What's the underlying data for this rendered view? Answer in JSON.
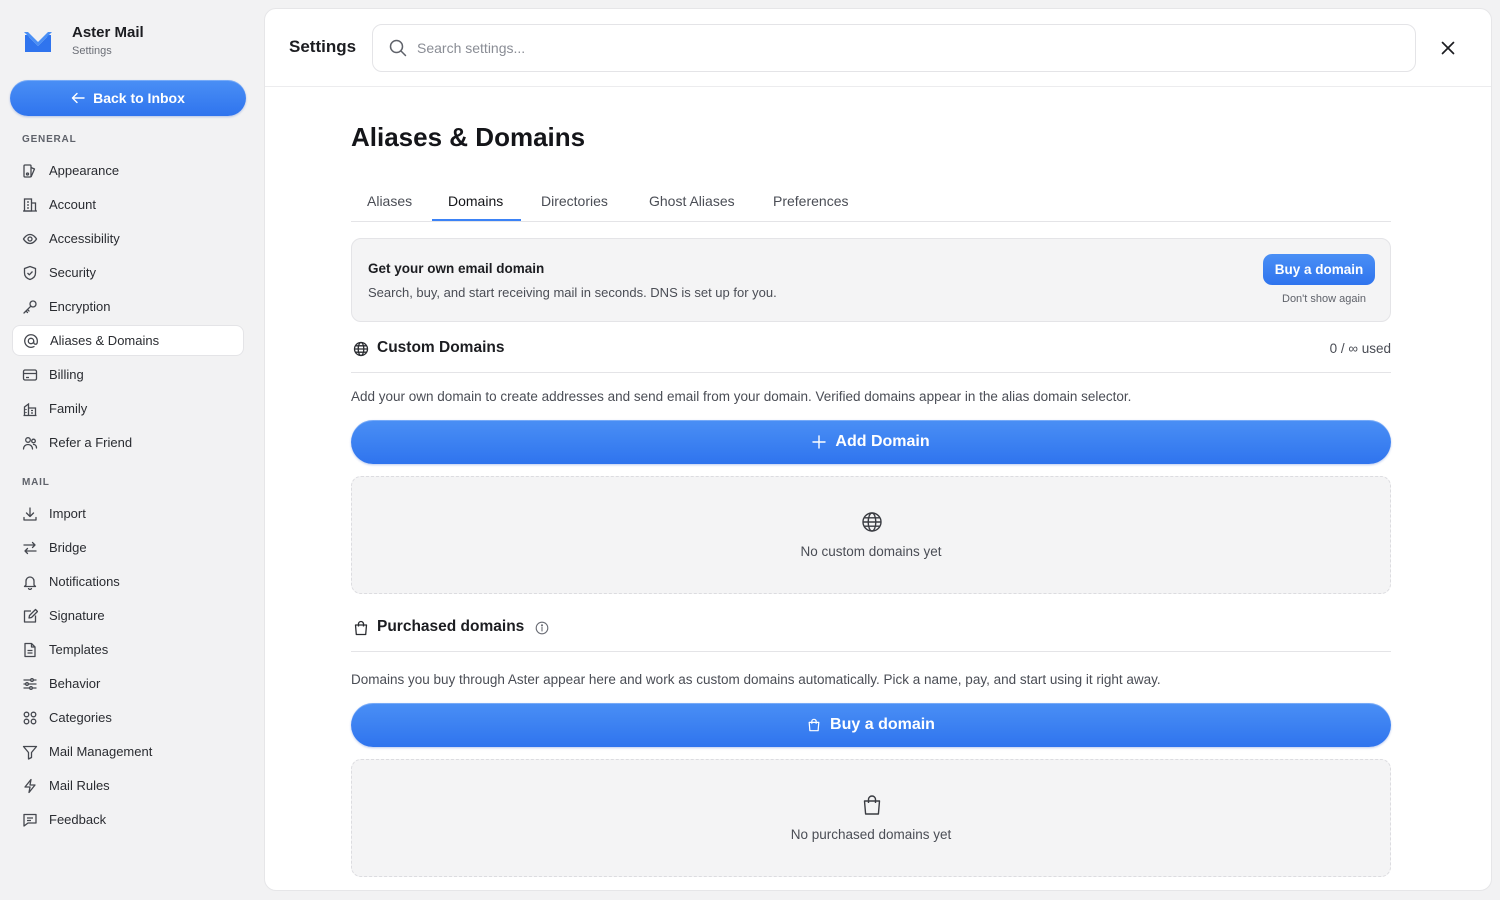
{
  "app": {
    "name": "Aster Mail",
    "subtitle": "Settings",
    "accent_color": "#3b82f6"
  },
  "sidebar": {
    "back_label": "Back to Inbox",
    "general_label": "GENERAL",
    "general_items": [
      {
        "label": "Appearance",
        "icon": "appearance-icon"
      },
      {
        "label": "Account",
        "icon": "building-icon"
      },
      {
        "label": "Accessibility",
        "icon": "eye-icon"
      },
      {
        "label": "Security",
        "icon": "shield-icon"
      },
      {
        "label": "Encryption",
        "icon": "key-icon"
      },
      {
        "label": "Aliases & Domains",
        "icon": "at-icon",
        "active": true
      },
      {
        "label": "Billing",
        "icon": "credit-card-icon"
      },
      {
        "label": "Family",
        "icon": "family-icon"
      },
      {
        "label": "Refer a Friend",
        "icon": "users-icon"
      }
    ],
    "mail_label": "MAIL",
    "mail_items": [
      {
        "label": "Import",
        "icon": "download-icon"
      },
      {
        "label": "Bridge",
        "icon": "arrows-icon"
      },
      {
        "label": "Notifications",
        "icon": "bell-icon"
      },
      {
        "label": "Signature",
        "icon": "pen-icon"
      },
      {
        "label": "Templates",
        "icon": "file-icon"
      },
      {
        "label": "Behavior",
        "icon": "sliders-icon"
      },
      {
        "label": "Categories",
        "icon": "grid-icon"
      },
      {
        "label": "Mail Management",
        "icon": "filter-icon"
      },
      {
        "label": "Mail Rules",
        "icon": "bolt-icon"
      },
      {
        "label": "Feedback",
        "icon": "message-icon"
      }
    ]
  },
  "header": {
    "title": "Settings",
    "search_placeholder": "Search settings..."
  },
  "page": {
    "title": "Aliases & Domains",
    "tabs": [
      {
        "label": "Aliases"
      },
      {
        "label": "Domains",
        "active": true
      },
      {
        "label": "Directories"
      },
      {
        "label": "Ghost Aliases"
      },
      {
        "label": "Preferences"
      }
    ]
  },
  "promo": {
    "title": "Get your own email domain",
    "description": "Search, buy, and start receiving mail in seconds. DNS is set up for you.",
    "button_label": "Buy a domain",
    "dismiss_label": "Don't show again"
  },
  "custom_domains": {
    "title": "Custom Domains",
    "usage": "0 / ∞ used",
    "description": "Add your own domain to create addresses and send email from your domain. Verified domains appear in the alias domain selector.",
    "button_label": "Add Domain",
    "empty_text": "No custom domains yet"
  },
  "purchased_domains": {
    "title": "Purchased domains",
    "description": "Domains you buy through Aster appear here and work as custom domains automatically. Pick a name, pay, and start using it right away.",
    "button_label": "Buy a domain",
    "empty_text": "No purchased domains yet"
  }
}
